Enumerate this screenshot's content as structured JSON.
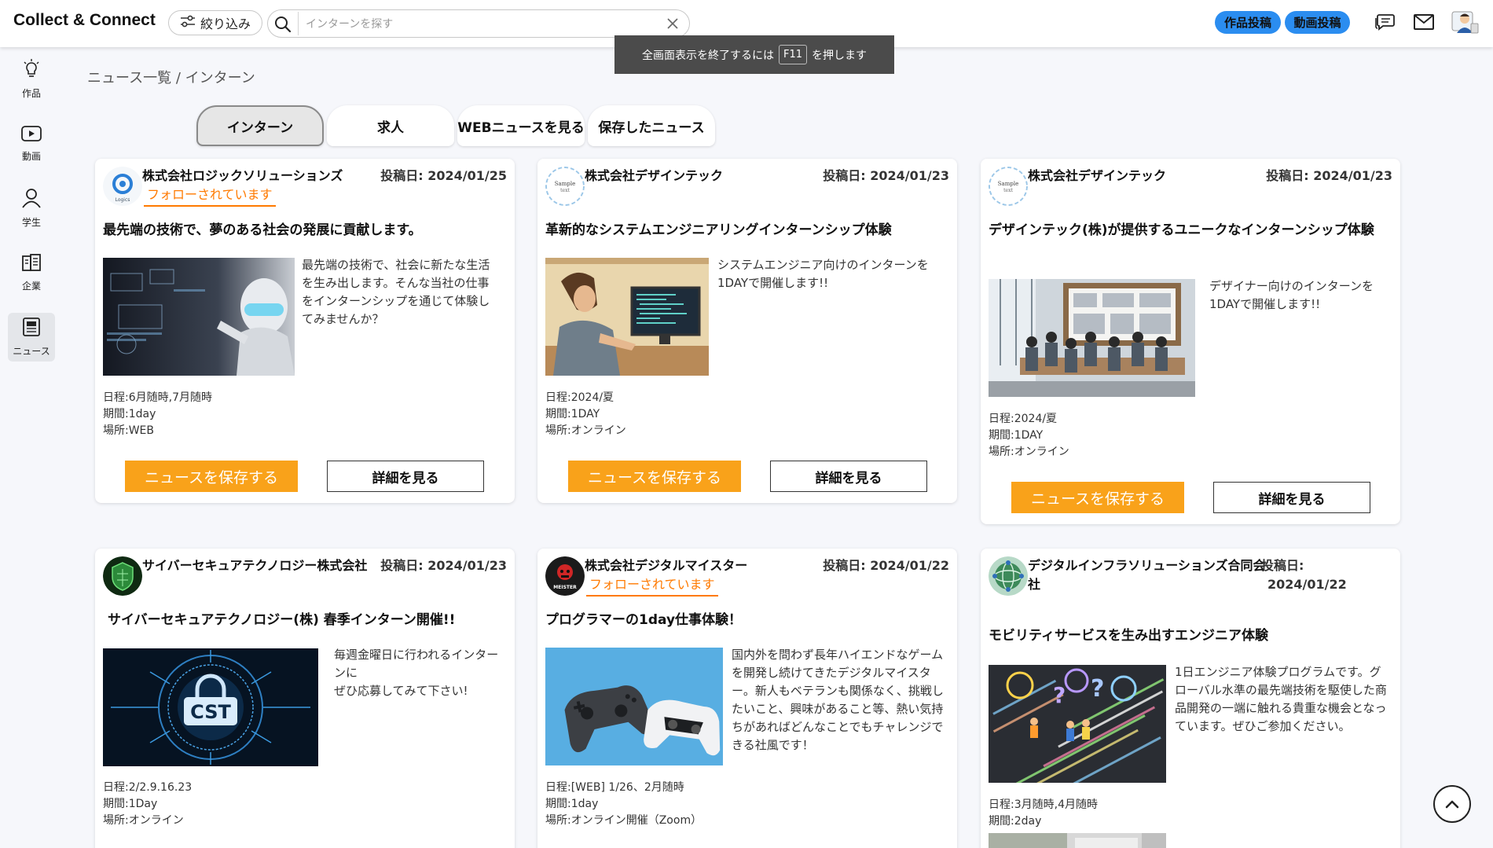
{
  "header": {
    "logo": "Collect & Connect",
    "filter_label": "絞り込み",
    "search_placeholder": "インターンを探す",
    "post_work_label": "作品投稿",
    "post_video_label": "動画投稿"
  },
  "fullscreen_toast": {
    "before": "全画面表示を終了するには",
    "key": "F11",
    "after": "を押します"
  },
  "sidebar": {
    "items": [
      {
        "label": "作品"
      },
      {
        "label": "動画"
      },
      {
        "label": "学生"
      },
      {
        "label": "企業"
      },
      {
        "label": "ニュース"
      }
    ]
  },
  "breadcrumb": "ニュース一覧 / インターン",
  "tabs": [
    {
      "label": "インターン",
      "active": true
    },
    {
      "label": "求人"
    },
    {
      "label": "WEBニュースを見る"
    },
    {
      "label": "保存したニュース"
    }
  ],
  "buttons": {
    "save": "ニュースを保存する",
    "detail": "詳細を見る"
  },
  "cards": [
    {
      "company": "株式会社ロジックソリューションズ",
      "date": "投稿日: 2024/01/25",
      "follow": "フォローされています",
      "headline": "最先端の技術で、夢のある社会の発展に貢献します。",
      "description": "最先端の技術で、社会に新たな生活を生み出します。そんな当社の仕事をインターンシップを通じて体験してみませんか？",
      "schedule": "日程:6月随時,7月随時",
      "period": "期間:1day",
      "location": "場所:WEB"
    },
    {
      "company": "株式会社デザインテック",
      "date": "投稿日: 2024/01/23",
      "headline": "革新的なシステムエンジニアリングインターンシップ体験",
      "description": "システムエンジニア向けのインターンを1DAYで開催します!!",
      "schedule": "日程:2024/夏",
      "period": "期間:1DAY",
      "location": "場所:オンライン"
    },
    {
      "company": "株式会社デザインテック",
      "date": "投稿日: 2024/01/23",
      "headline": "デザインテック(株)が提供するユニークなインターンシップ体験",
      "description": "デザイナー向けのインターンを1DAYで開催します!!",
      "schedule": "日程:2024/夏",
      "period": "期間:1DAY",
      "location": "場所:オンライン"
    },
    {
      "company": "サイバーセキュアテクノロジー株式会社",
      "date": "投稿日: 2024/01/23",
      "headline": "サイバーセキュアテクノロジー(株) 春季インターン開催!!",
      "description": "毎週金曜日に行われるインターンに\nぜひ応募してみて下さい!",
      "schedule": "日程:2/2.9.16.23",
      "period": "期間:1Day",
      "location": "場所:オンライン"
    },
    {
      "company": "株式会社デジタルマイスター",
      "date": "投稿日: 2024/01/22",
      "follow": "フォローされています",
      "headline": "プログラマーの1day仕事体験！",
      "description": "国内外を問わず長年ハイエンドなゲームを開発し続けてきたデジタルマイスター。新人もベテランも関係なく、挑戦したいこと、興味があること等、熱い気持ちがあればどんなことでもチャレンジできる社風です！",
      "schedule": "日程:[WEB] 1/26、2月随時",
      "period": "期間:1day",
      "location": "場所:オンライン開催（Zoom）"
    },
    {
      "company": "デジタルインフラソリューションズ合同会社",
      "date_label": "投稿日:",
      "date_value": "2024/01/22",
      "headline": "モビリティサービスを生み出すエンジニア体験",
      "description": "1日エンジニア体験プログラムです。グローバル水準の最先端技術を駆使した商品開発の一端に触れる貴重な機会となっています。ぜひご参加ください。",
      "schedule": "日程:3月随時,4月随時",
      "period": "期間:2day"
    }
  ],
  "colors": {
    "accent_orange": "#f9a21a",
    "follow_orange": "#ff7a00",
    "pill_blue": "#2b8df0",
    "background": "#f6f7fb"
  },
  "icons": [
    "filter-icon",
    "search-icon",
    "clear-icon",
    "chat-icon",
    "mail-icon",
    "user-avatar",
    "lightbulb-icon",
    "video-icon",
    "person-icon",
    "building-icon",
    "news-icon",
    "chevron-up-icon"
  ]
}
